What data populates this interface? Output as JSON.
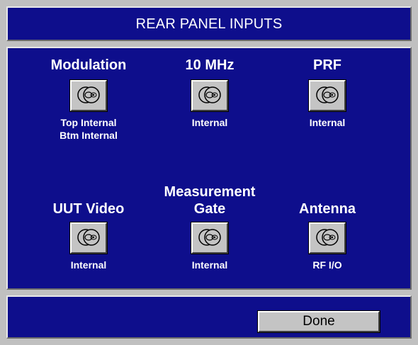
{
  "window": {
    "title": "REAR PANEL INPUTS"
  },
  "inputs": [
    {
      "label_lines": [
        "Modulation"
      ],
      "icon": "connector-icon",
      "value_lines": [
        "Top Internal",
        "Btm Internal"
      ]
    },
    {
      "label_lines": [
        "10 MHz"
      ],
      "icon": "connector-icon",
      "value_lines": [
        "Internal"
      ]
    },
    {
      "label_lines": [
        "PRF"
      ],
      "icon": "connector-icon",
      "value_lines": [
        "Internal"
      ]
    },
    {
      "label_lines": [
        "UUT Video"
      ],
      "icon": "connector-icon",
      "value_lines": [
        "Internal"
      ]
    },
    {
      "label_lines": [
        "Measurement",
        "Gate"
      ],
      "icon": "connector-icon",
      "value_lines": [
        "Internal"
      ]
    },
    {
      "label_lines": [
        "Antenna"
      ],
      "icon": "connector-icon",
      "value_lines": [
        "RF I/O"
      ]
    }
  ],
  "footer": {
    "done_label": "Done"
  },
  "colors": {
    "panel_background": "#0e0e8c",
    "window_background": "#c0c0c0",
    "button_face": "#c4c4c4",
    "text": "#ffffff"
  }
}
